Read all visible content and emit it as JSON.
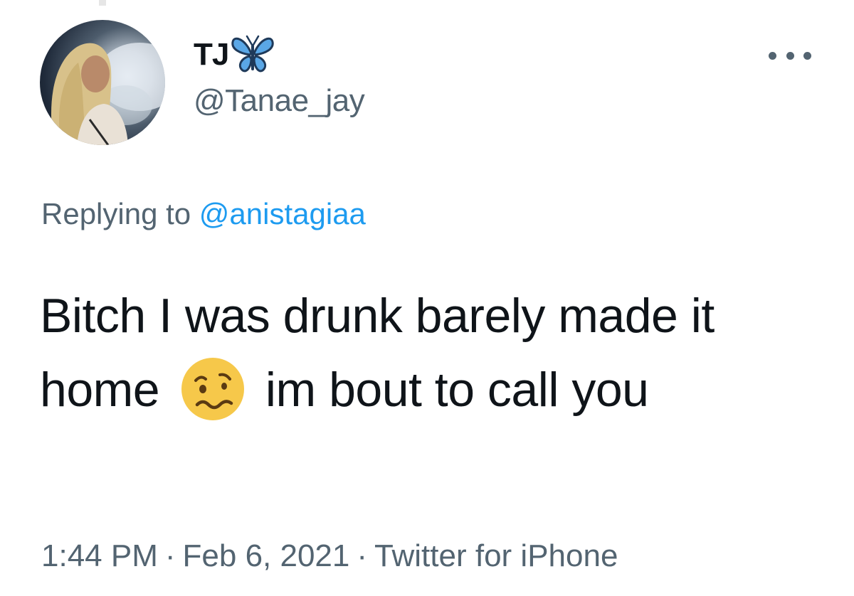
{
  "author": {
    "display_name": "TJ",
    "name_emoji_icon": "butterfly-icon",
    "handle": "@Tanae_jay",
    "avatar_icon": "profile-photo"
  },
  "reply": {
    "prefix": "Replying to",
    "handle": "@anistagiaa"
  },
  "tweet": {
    "text_part1": "Bitch I was drunk barely made it home",
    "emoji_icon": "woozy-face-icon",
    "text_part2": "im bout to call you"
  },
  "meta": {
    "time": "1:44 PM",
    "separator": "·",
    "date": "Feb 6, 2021",
    "source": "Twitter for iPhone"
  },
  "colors": {
    "text_primary": "#0f1419",
    "text_secondary": "#536471",
    "link": "#1d9bf0",
    "butterfly": "#5aa7e6",
    "emoji_face": "#f6c84a"
  }
}
